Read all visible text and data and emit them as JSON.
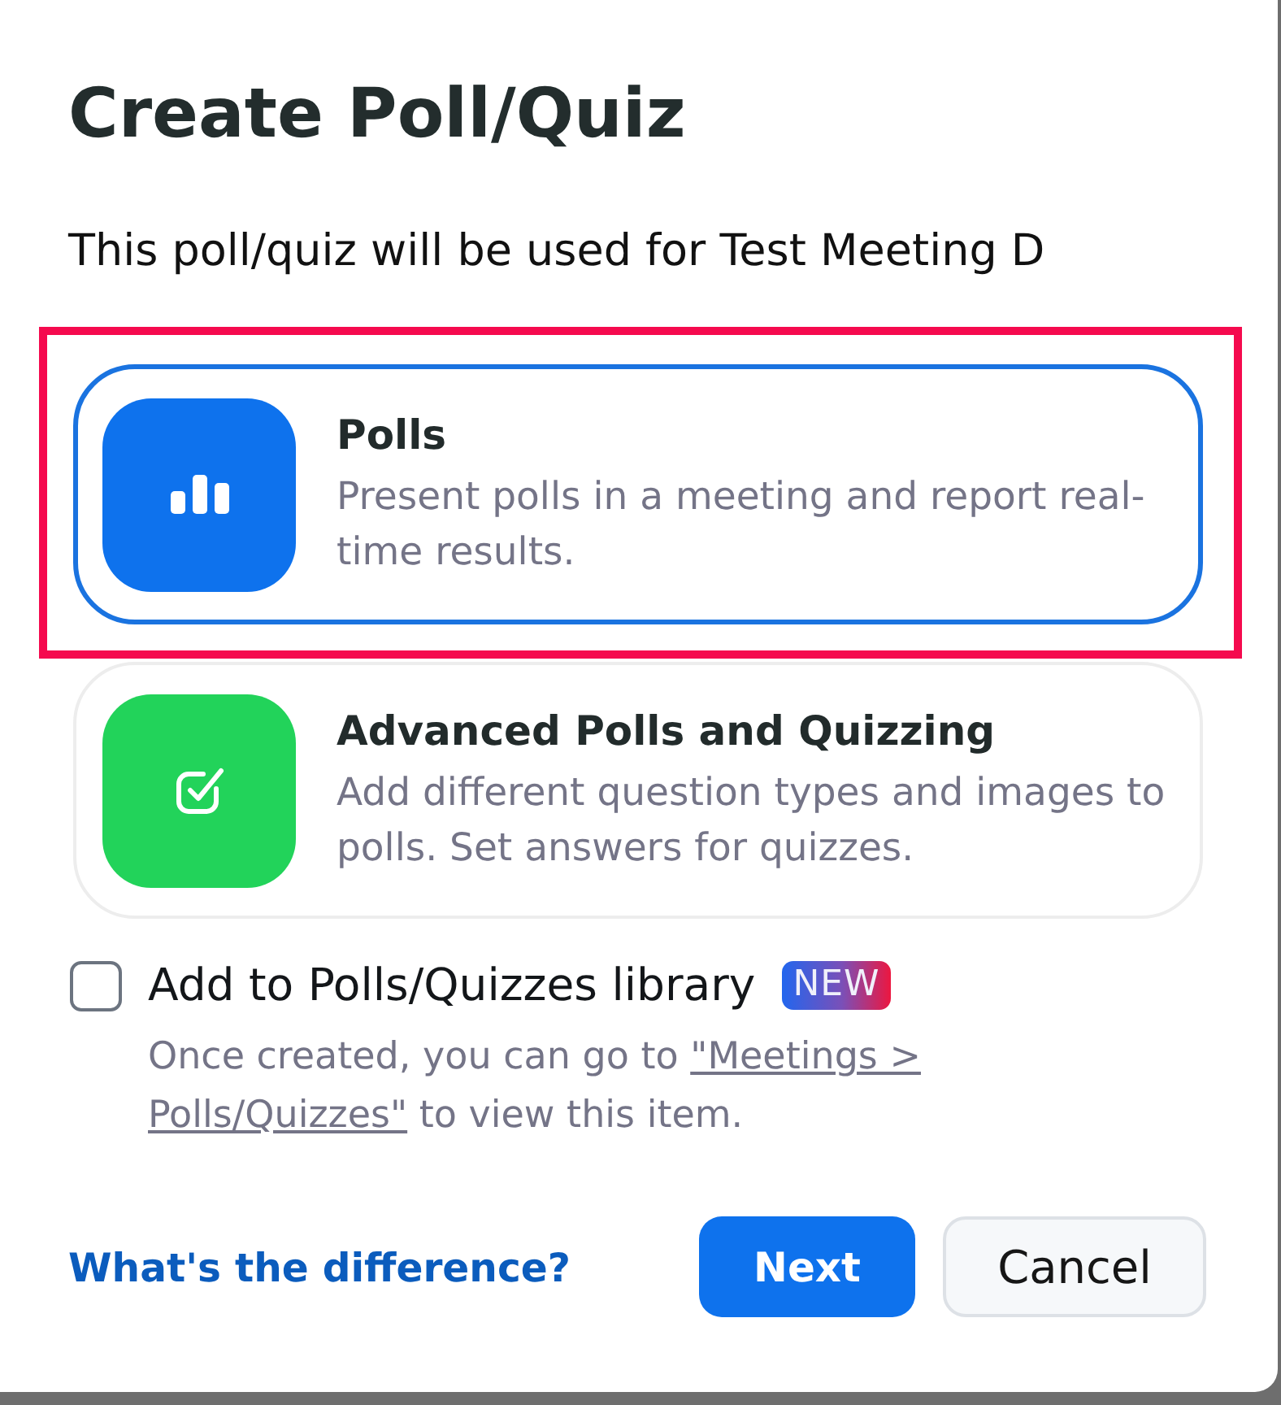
{
  "dialog": {
    "title": "Create Poll/Quiz",
    "subtitle": "This poll/quiz will be used for Test Meeting D"
  },
  "options": [
    {
      "kind": "polls",
      "title": "Polls",
      "description": "Present polls in a meeting and report real-time results.",
      "selected": true,
      "highlighted": true,
      "color": "#0e72ed"
    },
    {
      "kind": "quiz",
      "title": "Advanced Polls and Quizzing",
      "description": "Add different question types and images to polls. Set answers for quizzes.",
      "selected": false,
      "highlighted": false,
      "color": "#22d35a"
    }
  ],
  "library": {
    "label": "Add to Polls/Quizzes library",
    "checked": false,
    "badge": "NEW",
    "hint_before": "Once created, you can go to",
    "hint_link": [
      "\"Meetings >",
      "Polls/Quizzes\""
    ],
    "hint_after": "to view this item."
  },
  "footer": {
    "help_link": "What's the difference?",
    "buttons": [
      {
        "kind": "primary",
        "label": "Next"
      },
      {
        "kind": "secondary",
        "label": "Cancel"
      }
    ]
  }
}
